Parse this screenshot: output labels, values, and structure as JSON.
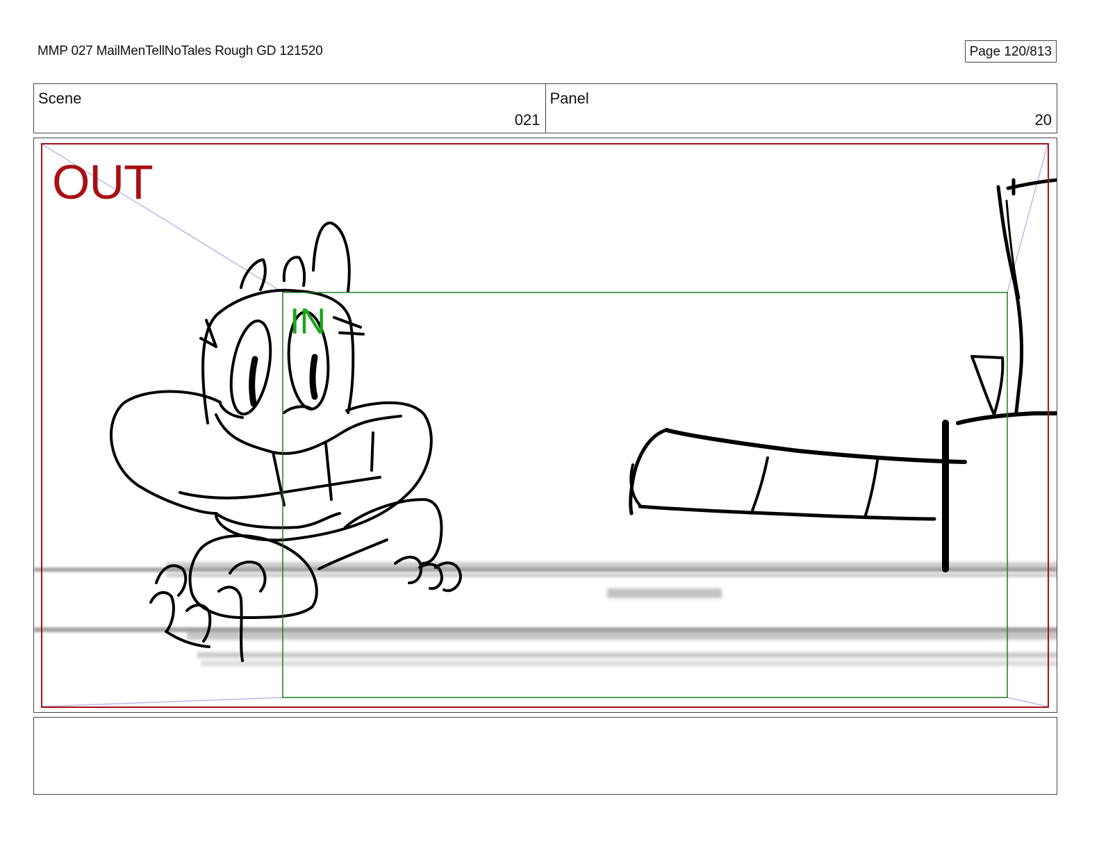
{
  "header": {
    "title": "MMP 027 MailMenTellNoTales Rough GD 121520",
    "page": "Page 120/813"
  },
  "info": {
    "scene_label": "Scene",
    "scene_value": "021",
    "panel_label": "Panel",
    "panel_value": "20"
  },
  "frame": {
    "out_label": "OUT",
    "in_label": "IN",
    "colors": {
      "out_frame": "#a80f14",
      "in_frame": "#1f7a1f",
      "in_label": "#17a617",
      "guide": "#b8b8ea",
      "sketch": "#000000",
      "motion_blur": "#9a9a9a"
    }
  },
  "notes": {
    "text": ""
  }
}
